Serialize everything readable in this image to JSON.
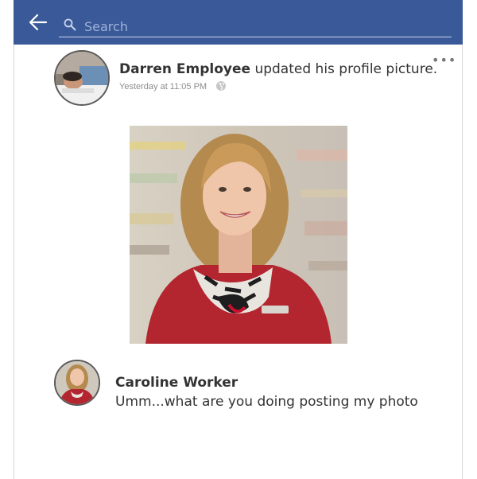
{
  "header": {
    "back_icon": "arrow-left-icon",
    "search_icon": "search-icon",
    "search_placeholder": "Search",
    "color": "#3a5998"
  },
  "post": {
    "author": "Darren Employee",
    "action": "updated his profile picture.",
    "timestamp": "Yesterday at 11:05 PM",
    "privacy_icon": "globe-icon",
    "more_label": "•••"
  },
  "comment": {
    "author": "Caroline Worker",
    "text": "Umm...what are you doing posting my photo"
  }
}
